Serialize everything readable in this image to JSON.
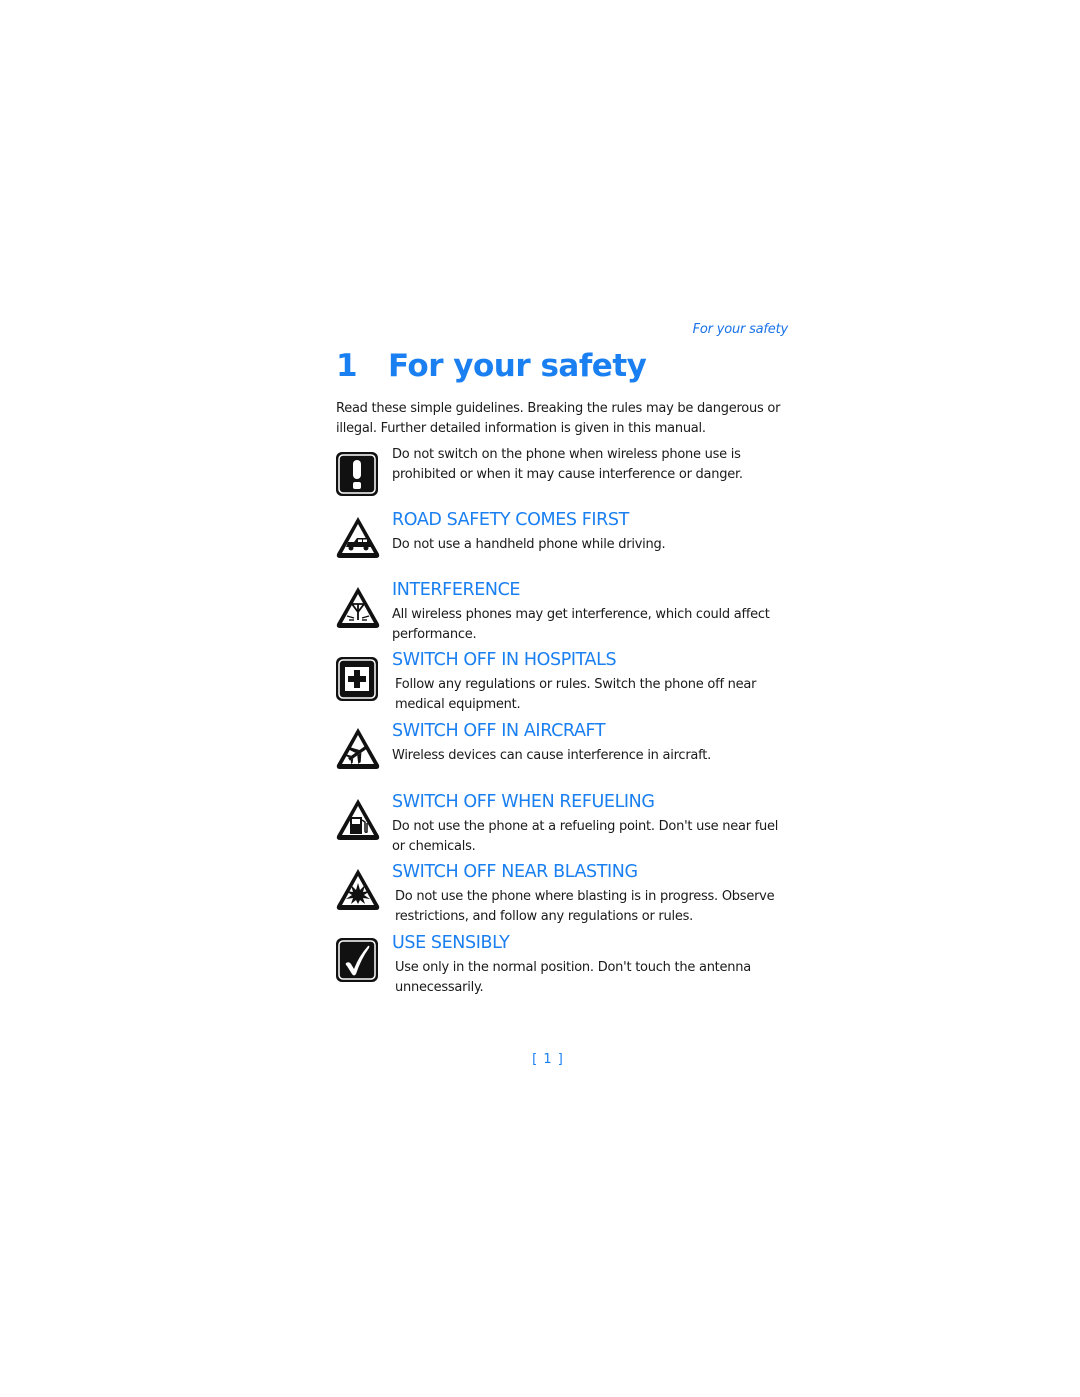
{
  "running_header": "For your safety",
  "chapter": {
    "number": "1",
    "title": "For your safety"
  },
  "intro": "Read these simple guidelines. Breaking the rules may be dangerous or illegal. Further detailed information is given in this manual.",
  "items": [
    {
      "icon": "exclamation-icon",
      "heading": "",
      "text": "Do not switch on the phone when wireless phone use is prohibited or when it may cause interference or danger."
    },
    {
      "icon": "car-warning-icon",
      "heading": "ROAD SAFETY COMES FIRST",
      "text": "Do not use a handheld phone while driving."
    },
    {
      "icon": "interference-warning-icon",
      "heading": "INTERFERENCE",
      "text": "All wireless phones may get interference, which could affect performance."
    },
    {
      "icon": "hospital-cross-icon",
      "heading": "SWITCH OFF IN HOSPITALS",
      "text": "Follow any regulations or rules. Switch the phone off near medical equipment."
    },
    {
      "icon": "aircraft-warning-icon",
      "heading": "SWITCH OFF IN AIRCRAFT",
      "text": "Wireless devices can cause interference in aircraft."
    },
    {
      "icon": "fuel-pump-warning-icon",
      "heading": "SWITCH OFF WHEN REFUELING",
      "text": "Do not use the phone at a refueling point. Don't use near fuel or chemicals."
    },
    {
      "icon": "blasting-warning-icon",
      "heading": "SWITCH OFF NEAR BLASTING",
      "text": "Do not use the phone where blasting is in progress. Observe restrictions, and follow any regulations or rules."
    },
    {
      "icon": "checkmark-icon",
      "heading": "USE SENSIBLY",
      "text": "Use only in the normal position. Don't touch the antenna unnecessarily."
    }
  ],
  "page_number": "[ 1 ]",
  "colors": {
    "accent": "#1a7ff0",
    "text": "#1a1a1a"
  }
}
